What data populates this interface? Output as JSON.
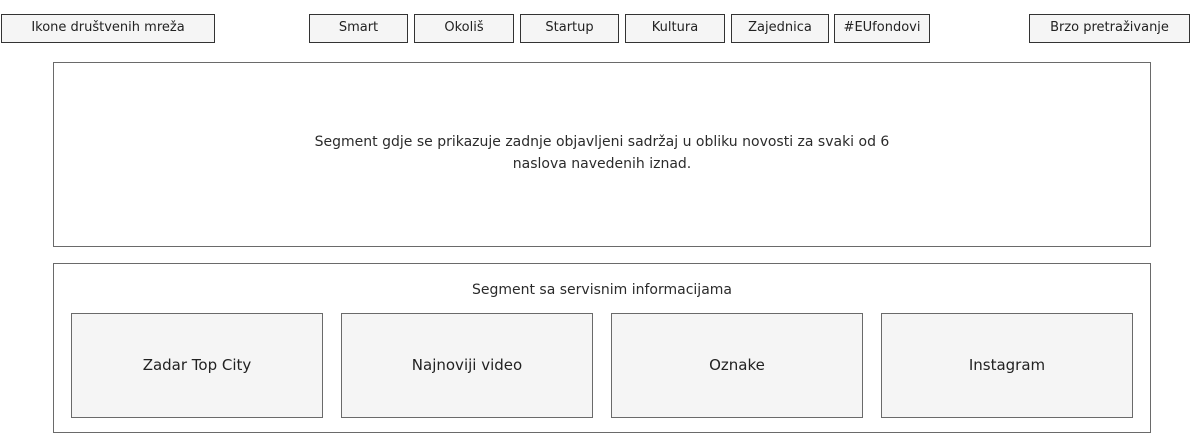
{
  "header": {
    "social_icons_label": "Ikone društvenih mreža",
    "categories": [
      {
        "label": "Smart"
      },
      {
        "label": "Okoliš"
      },
      {
        "label": "Startup"
      },
      {
        "label": "Kultura"
      },
      {
        "label": "Zajednica"
      },
      {
        "label": "#EUfondovi"
      }
    ],
    "quick_search_label": "Brzo pretraživanje"
  },
  "news_segment": {
    "line1": "Segment gdje se prikazuje zadnje objavljeni sadržaj  u obliku novosti za svaki od 6",
    "line2": "naslova navedenih iznad."
  },
  "service_segment": {
    "title": "Segment sa servisnim informacijama",
    "tiles": [
      {
        "label": "Zadar Top City"
      },
      {
        "label": "Najnoviji video"
      },
      {
        "label": "Oznake"
      },
      {
        "label": "Instagram"
      }
    ]
  }
}
